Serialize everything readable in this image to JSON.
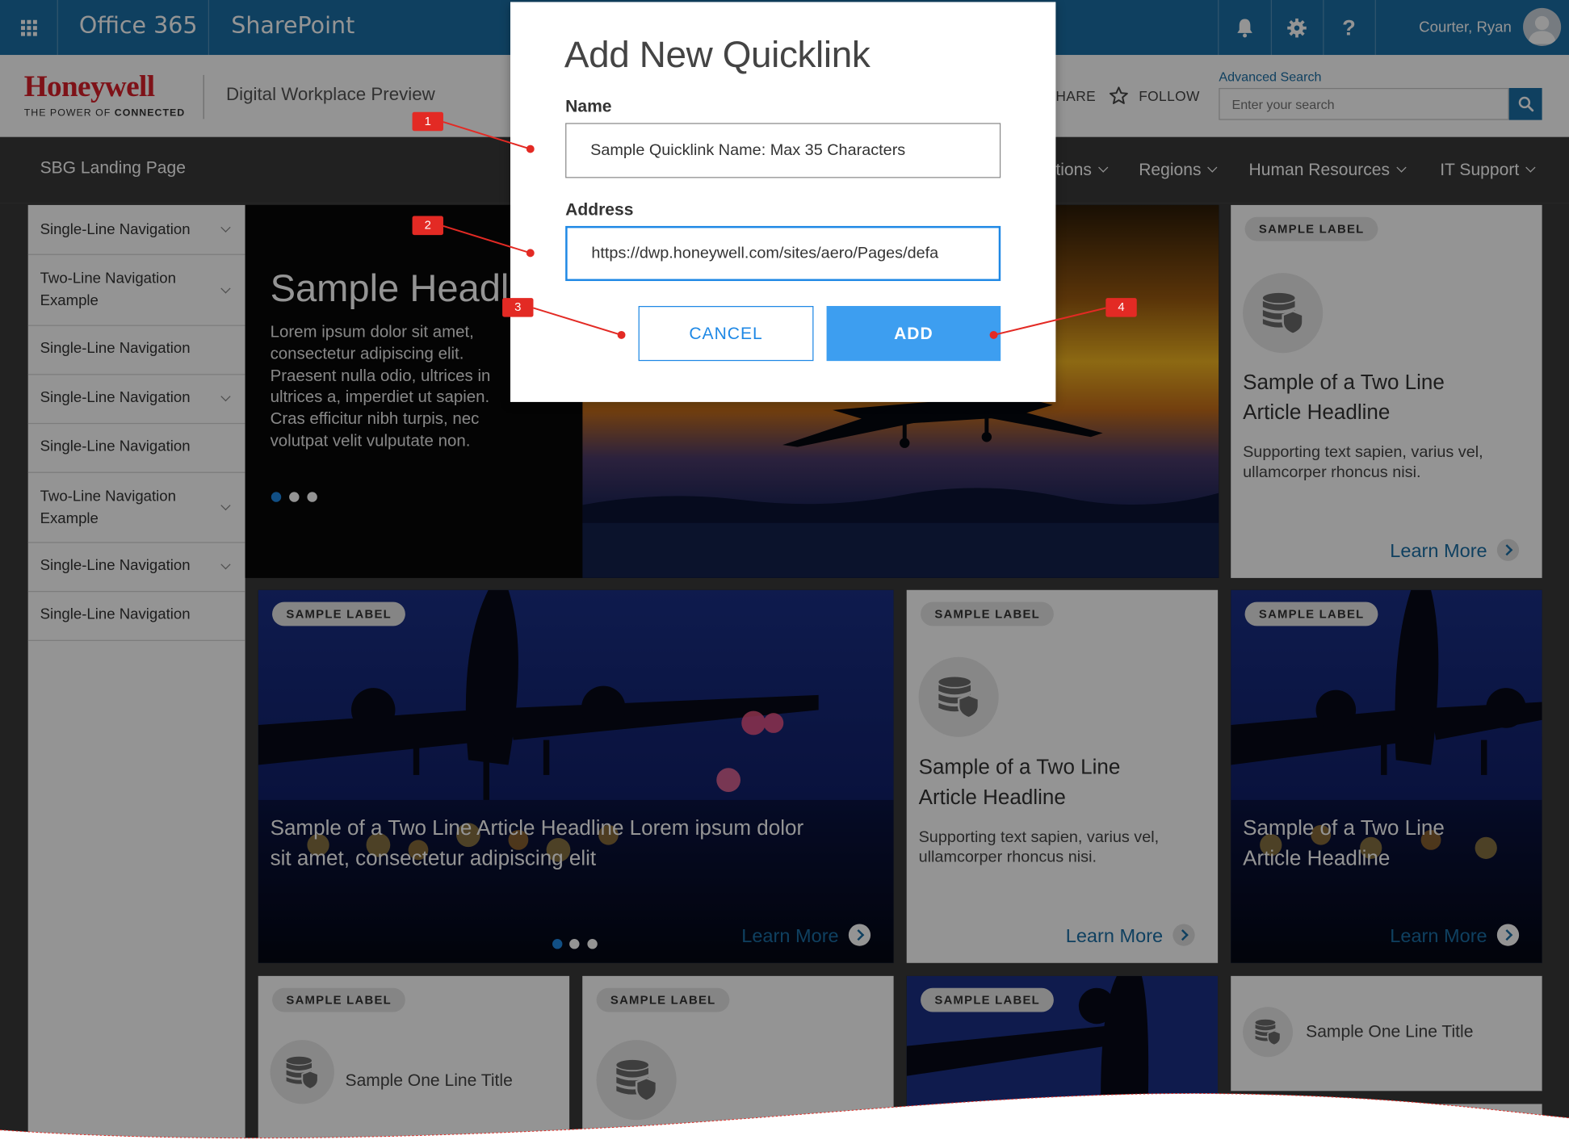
{
  "suite_bar": {
    "app_name": "Office 365",
    "product_name": "SharePoint",
    "user_name": "Courter, Ryan",
    "help_glyph": "?",
    "icons": [
      "waffle-icon",
      "bell-icon",
      "gear-icon",
      "help-icon",
      "avatar"
    ]
  },
  "site_header": {
    "logo_wordmark": "Honeywell",
    "logo_tagline_prefix": "THE POWER OF",
    "logo_tagline_bold": "CONNECTED",
    "site_title": "Digital Workplace Preview",
    "share_label": "HARE",
    "follow_label": "FOLLOW",
    "advanced_search": "Advanced Search",
    "search_placeholder": "Enter your search"
  },
  "nav": {
    "site_name": "SBG Landing Page",
    "items": [
      "tions",
      "Regions",
      "Human Resources",
      "IT Support"
    ]
  },
  "left_nav": {
    "items": [
      {
        "line1": "Single-Line Navigation",
        "line2": "",
        "expandable": true
      },
      {
        "line1": "Two-Line Navigation",
        "line2": "Example",
        "expandable": true
      },
      {
        "line1": "Single-Line Navigation",
        "line2": "",
        "expandable": false
      },
      {
        "line1": "Single-Line Navigation",
        "line2": "",
        "expandable": true
      },
      {
        "line1": "Single-Line Navigation",
        "line2": "",
        "expandable": false
      },
      {
        "line1": "Two-Line Navigation",
        "line2": "Example",
        "expandable": true
      },
      {
        "line1": "Single-Line Navigation",
        "line2": "",
        "expandable": true
      },
      {
        "line1": "Single-Line Navigation",
        "line2": "",
        "expandable": false
      }
    ]
  },
  "hero": {
    "headline": "Sample Headli",
    "body_lines": [
      "Lorem ipsum dolor sit amet,",
      "consectetur adipiscing elit.",
      "Praesent nulla odio, ultrices in",
      "ultrices a, imperdiet ut sapien.",
      "Cras efficitur nibh turpis, nec",
      "volutpat velit vulputate non."
    ]
  },
  "cards": {
    "right_top": {
      "label": "SAMPLE LABEL",
      "headline_lines": [
        "Sample of a Two Line",
        "Article Headline"
      ],
      "body_lines": [
        "Supporting text sapien, varius vel,",
        "ullamcorper rhoncus nisi."
      ],
      "link": "Learn More"
    },
    "feature": {
      "label": "SAMPLE LABEL",
      "headline_lines": [
        "Sample of a Two Line Article Headline Lorem ipsum dolor",
        "sit amet, consectetur adipiscing elit"
      ],
      "link": "Learn More"
    },
    "middle": {
      "label": "SAMPLE LABEL",
      "headline_lines": [
        "Sample of a Two Line",
        "Article Headline"
      ],
      "body_lines": [
        "Supporting text sapien, varius vel,",
        "ullamcorper rhoncus nisi."
      ],
      "link": "Learn More"
    },
    "right_photo": {
      "label": "SAMPLE LABEL",
      "headline_lines": [
        "Sample of a Two Line",
        "Article Headline"
      ],
      "link": "Learn More"
    },
    "bottom_1": {
      "label": "SAMPLE LABEL",
      "title": "Sample One Line Title"
    },
    "bottom_2": {
      "label": "SAMPLE LABEL"
    },
    "bottom_3": {
      "label": "SAMPLE LABEL"
    },
    "bottom_4": {
      "title": "Sample One Line Title"
    }
  },
  "modal": {
    "title": "Add New Quicklink",
    "name_label": "Name",
    "name_value": "Sample Quicklink Name: Max 35 Characters",
    "address_label": "Address",
    "address_value": "https://dwp.honeywell.com/sites/aero/Pages/defa",
    "cancel_label": "CANCEL",
    "add_label": "ADD"
  },
  "annotations": [
    "1",
    "2",
    "3",
    "4"
  ],
  "colors": {
    "suite_bar": "#1b6fa6",
    "brand_red": "#d9202a",
    "primary_blue": "#3d9ef0",
    "link_blue": "#1b6fa6",
    "annotation_red": "#e32a24",
    "nav_dark": "#3a3a3a"
  }
}
